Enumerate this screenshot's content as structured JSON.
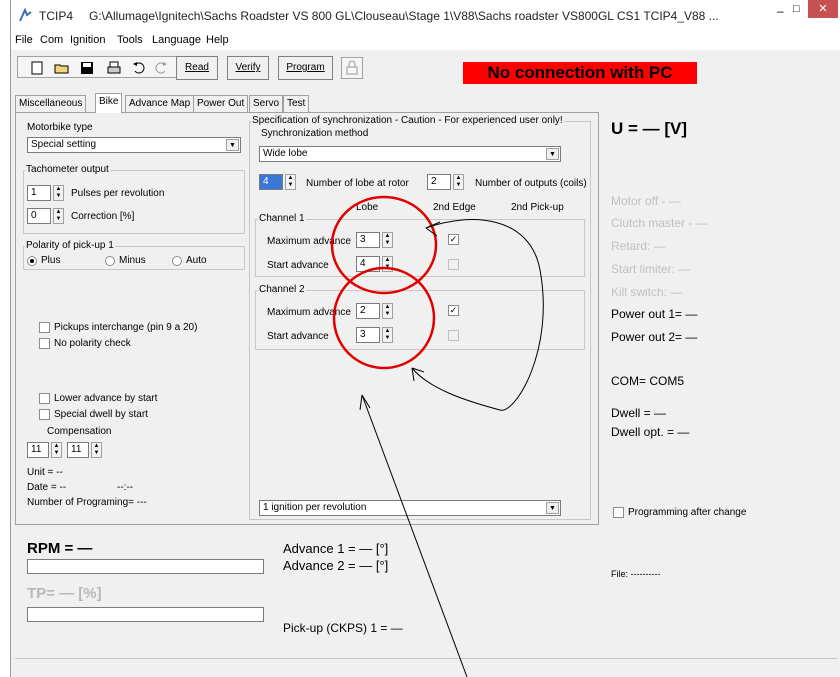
{
  "titlebar": {
    "app": "TCIP4",
    "path": "G:\\Allumage\\Ignitech\\Sachs Roadster VS 800 GL\\Clouseau\\Stage 1\\V88\\Sachs roadster VS800GL CS1 TCIP4_V88 ...",
    "minimize": "–",
    "maximize": "□",
    "close": "✕"
  },
  "menu": [
    "File",
    "Com",
    "Ignition",
    "Tools",
    "Language",
    "Help"
  ],
  "toolbar": {
    "read": "Read",
    "verify": "Verify",
    "program": "Program",
    "status": "No connection with PC",
    "status_bg": "#ff0000",
    "status_color": "#000000"
  },
  "tabs": [
    "Miscellaneous",
    "Bike",
    "Advance Map",
    "Power Out",
    "Servo",
    "Test"
  ],
  "left": {
    "motorbike_type_label": "Motorbike type",
    "motorbike_type_value": "Special setting",
    "tacho_group": "Tachometer output",
    "pulses_value": "1",
    "pulses_label": "Pulses per revolution",
    "correction_value": "0",
    "correction_label": "Correction [%]",
    "polarity_group": "Polarity of pick-up 1",
    "plus": "Plus",
    "minus": "Minus",
    "auto": "Auto",
    "pickups_interchange": "Pickups interchange (pin 9 a 20)",
    "no_polarity_check": "No polarity check",
    "lower_advance": "Lower advance by start",
    "special_dwell": "Special dwell by start",
    "compensation": "Compensation",
    "comp1": "11",
    "comp2": "11",
    "unit": "Unit = --",
    "date": "Date = --",
    "time": "--:--",
    "num_programming": "Number of Programing= ---"
  },
  "sync": {
    "group": "Specification of synchronization - Caution - For experienced user only!",
    "method_label": "Synchronization method",
    "method_value": "Wide lobe",
    "lobes_value": "4",
    "lobes_label": "Number of lobe at rotor",
    "outputs_value": "2",
    "outputs_label": "Number of outputs (coils)",
    "col_lobe": "Lobe",
    "col_2nd_edge": "2nd Edge",
    "col_2nd_pickup": "2nd Pick-up",
    "channel1": "Channel 1",
    "channel2": "Channel 2",
    "max_advance": "Maximum advance",
    "start_advance": "Start advance",
    "ch1_max": "3",
    "ch1_start": "4",
    "ch2_max": "2",
    "ch2_start": "3",
    "check_mark": "✓",
    "ignition_value": "1 ignition per revolution"
  },
  "right": {
    "voltage": "U = — [V]",
    "motor_off": "Motor off - —",
    "clutch_master": "Clutch master - —",
    "retard": "Retard: —",
    "start_limiter": "Start limiter: —",
    "kill_switch": "Kill switch: —",
    "power_out1": "Power out 1= —",
    "power_out2": "Power out 2= —",
    "com": "COM= COM5",
    "dwell": "Dwell = —",
    "dwell_opt": "Dwell opt. = —",
    "programming_after_change": "Programming after change",
    "file": "File: ----------"
  },
  "bottom": {
    "rpm": "RPM = —",
    "tp": "TP= — [%]",
    "advance1": "Advance 1 = — [°]",
    "advance2": "Advance 2 = — [°]",
    "pickup": "Pick-up (CKPS) 1 = —"
  },
  "annotation_color": "#e00000"
}
